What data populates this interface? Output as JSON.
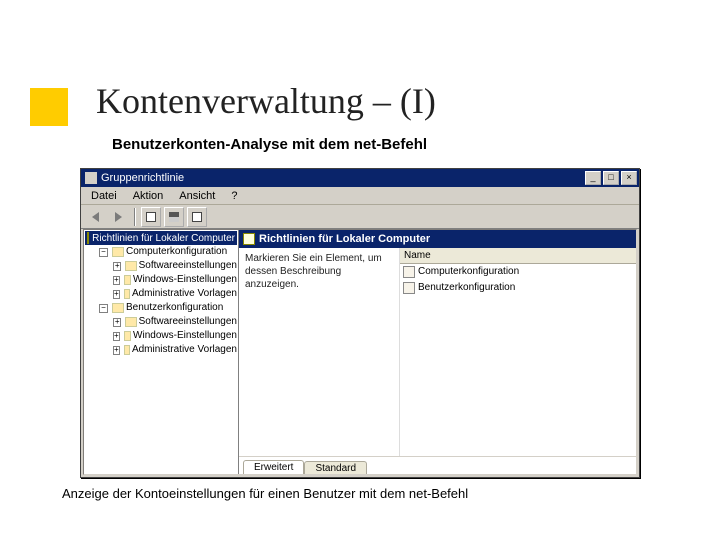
{
  "slide": {
    "title": "Kontenverwaltung – (I)",
    "subtitle": "Benutzerkonten-Analyse mit dem net-Befehl",
    "footer": "Anzeige der Kontoeinstellungen für einen Benutzer mit dem net-Befehl"
  },
  "window": {
    "title": "Gruppenrichtlinie",
    "menu": {
      "file": "Datei",
      "action": "Aktion",
      "view": "Ansicht",
      "help": "?"
    },
    "tree": {
      "root": "Richtlinien für Lokaler Computer",
      "items": [
        {
          "pm": "−",
          "label": "Computerkonfiguration"
        },
        {
          "pm": "+",
          "label": "Softwareeinstellungen"
        },
        {
          "pm": "+",
          "label": "Windows-Einstellungen"
        },
        {
          "pm": "+",
          "label": "Administrative Vorlagen"
        },
        {
          "pm": "−",
          "label": "Benutzerkonfiguration"
        },
        {
          "pm": "+",
          "label": "Softwareeinstellungen"
        },
        {
          "pm": "+",
          "label": "Windows-Einstellungen"
        },
        {
          "pm": "+",
          "label": "Administrative Vorlagen"
        }
      ]
    },
    "right": {
      "header": "Richtlinien für Lokaler Computer",
      "desc": "Markieren Sie ein Element, um dessen Beschreibung anzuzeigen.",
      "col_name": "Name",
      "items": [
        "Computerkonfiguration",
        "Benutzerkonfiguration"
      ]
    },
    "tabs": {
      "extended": "Erweitert",
      "standard": "Standard"
    }
  }
}
